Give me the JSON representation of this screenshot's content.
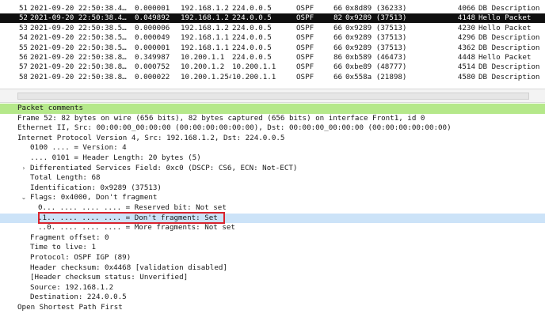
{
  "packet_list": {
    "rows": [
      {
        "no": "51",
        "time": "2021-09-20 22:50:38.4…",
        "delta": "0.000001",
        "source": "192.168.1.2",
        "destination": "224.0.0.5",
        "protocol": "OSPF",
        "length": "66",
        "ip_id": "0x8d89 (36233)",
        "length_b": "4066",
        "info": "DB Description",
        "selected": false
      },
      {
        "no": "52",
        "time": "2021-09-20 22:50:38.4…",
        "delta": "0.049892",
        "source": "192.168.1.2",
        "destination": "224.0.0.5",
        "protocol": "OSPF",
        "length": "82",
        "ip_id": "0x9289 (37513)",
        "length_b": "4148",
        "info": "Hello Packet",
        "selected": true
      },
      {
        "no": "53",
        "time": "2021-09-20 22:50:38.5…",
        "delta": "0.000006",
        "source": "192.168.1.2",
        "destination": "224.0.0.5",
        "protocol": "OSPF",
        "length": "66",
        "ip_id": "0x9289 (37513)",
        "length_b": "4230",
        "info": "Hello Packet",
        "selected": false
      },
      {
        "no": "54",
        "time": "2021-09-20 22:50:38.5…",
        "delta": "0.000049",
        "source": "192.168.1.1",
        "destination": "224.0.0.5",
        "protocol": "OSPF",
        "length": "66",
        "ip_id": "0x9289 (37513)",
        "length_b": "4296",
        "info": "DB Description",
        "selected": false
      },
      {
        "no": "55",
        "time": "2021-09-20 22:50:38.5…",
        "delta": "0.000001",
        "source": "192.168.1.1",
        "destination": "224.0.0.5",
        "protocol": "OSPF",
        "length": "66",
        "ip_id": "0x9289 (37513)",
        "length_b": "4362",
        "info": "DB Description",
        "selected": false
      },
      {
        "no": "56",
        "time": "2021-09-20 22:50:38.8…",
        "delta": "0.349987",
        "source": "10.200.1.1",
        "destination": "224.0.0.5",
        "protocol": "OSPF",
        "length": "86",
        "ip_id": "0xb589 (46473)",
        "length_b": "4448",
        "info": "Hello Packet",
        "selected": false
      },
      {
        "no": "57",
        "time": "2021-09-20 22:50:38.8…",
        "delta": "0.000752",
        "source": "10.200.1.2",
        "destination": "10.200.1.1",
        "protocol": "OSPF",
        "length": "66",
        "ip_id": "0xbe89 (48777)",
        "length_b": "4514",
        "info": "DB Description",
        "selected": false
      },
      {
        "no": "58",
        "time": "2021-09-20 22:50:38.8…",
        "delta": "0.000022",
        "source": "10.200.1.254",
        "destination": "10.200.1.1",
        "protocol": "OSPF",
        "length": "66",
        "ip_id": "0x558a (21898)",
        "length_b": "4580",
        "info": "DB Description",
        "selected": false
      }
    ]
  },
  "details": {
    "lines": [
      {
        "text": "Packet comments",
        "indent": 0,
        "twisty": "",
        "style": "comments"
      },
      {
        "text": "Frame 52: 82 bytes on wire (656 bits), 82 bytes captured (656 bits) on interface Front1, id 0",
        "indent": 0,
        "twisty": "",
        "style": ""
      },
      {
        "text": "Ethernet II, Src: 00:00:00_00:00:00 (00:00:00:00:00:00), Dst: 00:00:00_00:00:00 (00:00:00:00:00:00)",
        "indent": 0,
        "twisty": "",
        "style": ""
      },
      {
        "text": "Internet Protocol Version 4, Src: 192.168.1.2, Dst: 224.0.0.5",
        "indent": 0,
        "twisty": "",
        "style": ""
      },
      {
        "text": "0100 .... = Version: 4",
        "indent": 2,
        "twisty": "",
        "style": ""
      },
      {
        "text": ".... 0101 = Header Length: 20 bytes (5)",
        "indent": 2,
        "twisty": "",
        "style": ""
      },
      {
        "text": "Differentiated Services Field: 0xc0 (DSCP: CS6, ECN: Not-ECT)",
        "indent": 1,
        "twisty": "collapsed",
        "style": ""
      },
      {
        "text": "Total Length: 68",
        "indent": 1,
        "twisty": "",
        "style": ""
      },
      {
        "text": "Identification: 0x9289 (37513)",
        "indent": 1,
        "twisty": "",
        "style": ""
      },
      {
        "text": "Flags: 0x4000, Don't fragment",
        "indent": 1,
        "twisty": "expanded",
        "style": ""
      },
      {
        "text": "0... .... .... .... = Reserved bit: Not set",
        "indent": 3,
        "twisty": "",
        "style": ""
      },
      {
        "text": ".1.. .... .... .... = Don't fragment: Set",
        "indent": 3,
        "twisty": "",
        "style": "highlight"
      },
      {
        "text": "..0. .... .... .... = More fragments: Not set",
        "indent": 3,
        "twisty": "",
        "style": ""
      },
      {
        "text": "Fragment offset: 0",
        "indent": 1,
        "twisty": "",
        "style": ""
      },
      {
        "text": "Time to live: 1",
        "indent": 1,
        "twisty": "",
        "style": ""
      },
      {
        "text": "Protocol: OSPF IGP (89)",
        "indent": 1,
        "twisty": "",
        "style": ""
      },
      {
        "text": "Header checksum: 0x4468 [validation disabled]",
        "indent": 1,
        "twisty": "",
        "style": ""
      },
      {
        "text": "[Header checksum status: Unverified]",
        "indent": 1,
        "twisty": "",
        "style": ""
      },
      {
        "text": "Source: 192.168.1.2",
        "indent": 1,
        "twisty": "",
        "style": ""
      },
      {
        "text": "Destination: 224.0.0.5",
        "indent": 1,
        "twisty": "",
        "style": ""
      },
      {
        "text": "Open Shortest Path First",
        "indent": 0,
        "twisty": "",
        "style": ""
      }
    ],
    "twisty_glyphs": {
      "collapsed": "›",
      "expanded": "⌄"
    }
  },
  "colors": {
    "selected_row_bg": "#0f0f0f",
    "comments_bg": "#b5e88a",
    "highlight_bg": "#cce3f8",
    "annotation_border": "#d9232d"
  }
}
